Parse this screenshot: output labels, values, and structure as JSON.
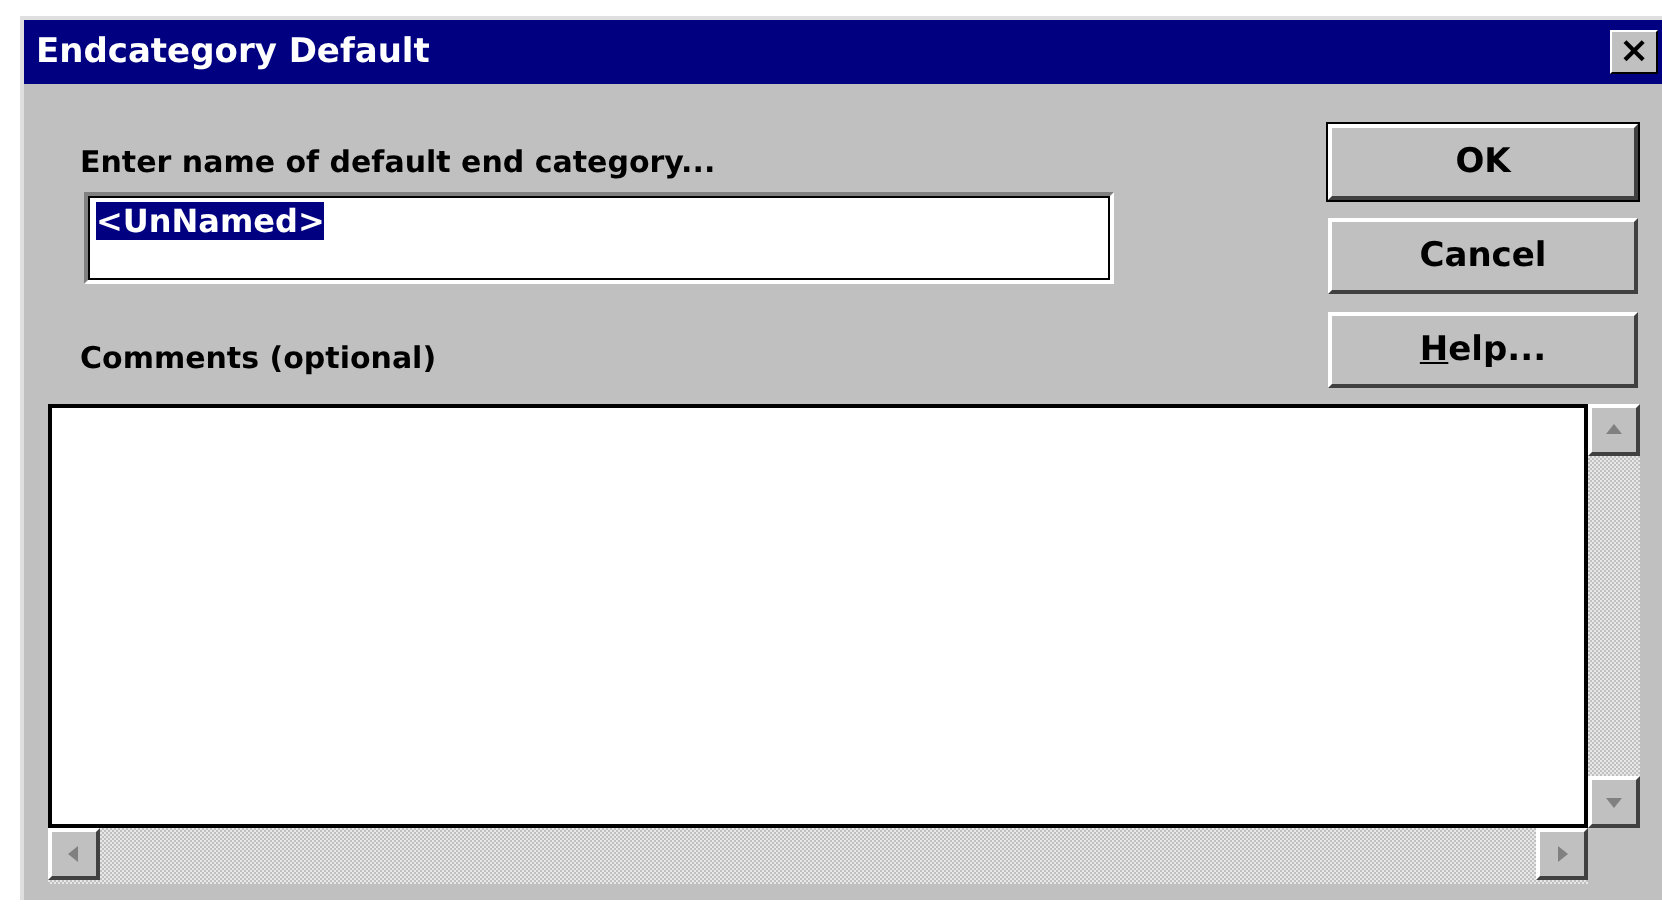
{
  "window": {
    "title": "Endcategory Default",
    "close": "×"
  },
  "name_field": {
    "label": "Enter name of default end category...",
    "value": "<UnNamed>",
    "selected_text": true
  },
  "comments": {
    "label": "Comments (optional)"
  },
  "buttons": [
    {
      "default": true,
      "parts": [
        {
          "text": "OK",
          "underlined": false
        }
      ]
    },
    {
      "default": false,
      "parts": [
        {
          "text": "Cancel",
          "underlined": false
        }
      ]
    },
    {
      "default": false,
      "parts": [
        {
          "text": "H",
          "underlined": true
        },
        {
          "text": "elp...",
          "underlined": false
        }
      ]
    }
  ]
}
